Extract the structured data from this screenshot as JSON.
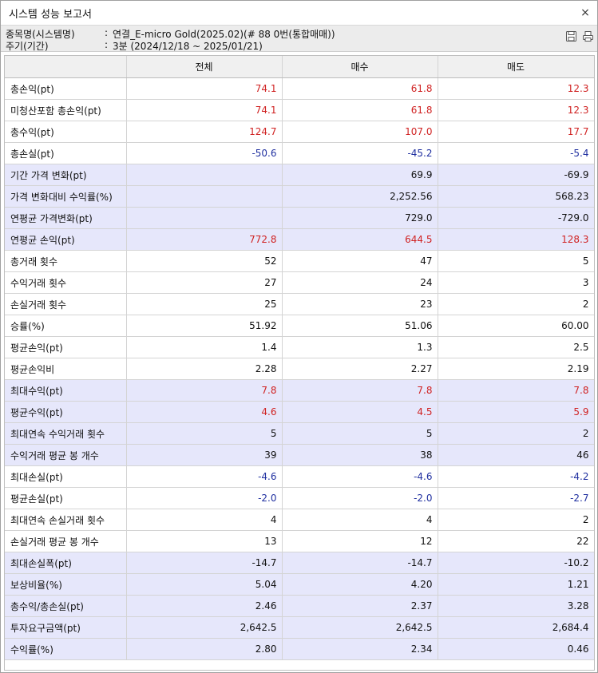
{
  "window": {
    "title": "시스템 성능 보고서",
    "close_glyph": "×"
  },
  "info": {
    "symbol_label": "종목명(시스템명)",
    "symbol_sep": ":",
    "symbol_value": "연결_E-micro Gold(2025.02)(# 88 0번(통합매매))",
    "period_label": "주기(기간)",
    "period_sep": ":",
    "period_value": "3분 (2024/12/18 ~ 2025/01/21)",
    "icons": [
      "save-icon",
      "print-icon"
    ]
  },
  "table": {
    "headers": [
      "",
      "전체",
      "매수",
      "매도"
    ],
    "rows": [
      {
        "label": "총손익(pt)",
        "values": [
          "74.1",
          "61.8",
          "12.3"
        ],
        "color": "red",
        "hl": false
      },
      {
        "label": "미청산포함 총손익(pt)",
        "values": [
          "74.1",
          "61.8",
          "12.3"
        ],
        "color": "red",
        "hl": false
      },
      {
        "label": "총수익(pt)",
        "values": [
          "124.7",
          "107.0",
          "17.7"
        ],
        "color": "red",
        "hl": false
      },
      {
        "label": "총손실(pt)",
        "values": [
          "-50.6",
          "-45.2",
          "-5.4"
        ],
        "color": "blue",
        "hl": false
      },
      {
        "label": "기간 가격 변화(pt)",
        "values": [
          "",
          "69.9",
          "-69.9"
        ],
        "color": "",
        "hl": true
      },
      {
        "label": "가격 변화대비 수익률(%)",
        "values": [
          "",
          "2,252.56",
          "568.23"
        ],
        "color": "",
        "hl": true
      },
      {
        "label": "연평균 가격변화(pt)",
        "values": [
          "",
          "729.0",
          "-729.0"
        ],
        "color": "",
        "hl": true
      },
      {
        "label": "연평균 손익(pt)",
        "values": [
          "772.8",
          "644.5",
          "128.3"
        ],
        "color": "red",
        "hl": true
      },
      {
        "label": "총거래 횟수",
        "values": [
          "52",
          "47",
          "5"
        ],
        "color": "",
        "hl": false
      },
      {
        "label": "수익거래 횟수",
        "values": [
          "27",
          "24",
          "3"
        ],
        "color": "",
        "hl": false
      },
      {
        "label": "손실거래 횟수",
        "values": [
          "25",
          "23",
          "2"
        ],
        "color": "",
        "hl": false
      },
      {
        "label": "승률(%)",
        "values": [
          "51.92",
          "51.06",
          "60.00"
        ],
        "color": "",
        "hl": false
      },
      {
        "label": "평균손익(pt)",
        "values": [
          "1.4",
          "1.3",
          "2.5"
        ],
        "color": "",
        "hl": false
      },
      {
        "label": "평균손익비",
        "values": [
          "2.28",
          "2.27",
          "2.19"
        ],
        "color": "",
        "hl": false
      },
      {
        "label": "최대수익(pt)",
        "values": [
          "7.8",
          "7.8",
          "7.8"
        ],
        "color": "red",
        "hl": true
      },
      {
        "label": "평균수익(pt)",
        "values": [
          "4.6",
          "4.5",
          "5.9"
        ],
        "color": "red",
        "hl": true
      },
      {
        "label": "최대연속 수익거래 횟수",
        "values": [
          "5",
          "5",
          "2"
        ],
        "color": "",
        "hl": true
      },
      {
        "label": "수익거래 평균 봉 개수",
        "values": [
          "39",
          "38",
          "46"
        ],
        "color": "",
        "hl": true
      },
      {
        "label": "최대손실(pt)",
        "values": [
          "-4.6",
          "-4.6",
          "-4.2"
        ],
        "color": "blue",
        "hl": false
      },
      {
        "label": "평균손실(pt)",
        "values": [
          "-2.0",
          "-2.0",
          "-2.7"
        ],
        "color": "blue",
        "hl": false
      },
      {
        "label": "최대연속 손실거래 횟수",
        "values": [
          "4",
          "4",
          "2"
        ],
        "color": "",
        "hl": false
      },
      {
        "label": "손실거래 평균 봉 개수",
        "values": [
          "13",
          "12",
          "22"
        ],
        "color": "",
        "hl": false
      },
      {
        "label": "최대손실폭(pt)",
        "values": [
          "-14.7",
          "-14.7",
          "-10.2"
        ],
        "color": "",
        "hl": true
      },
      {
        "label": "보상비율(%)",
        "values": [
          "5.04",
          "4.20",
          "1.21"
        ],
        "color": "",
        "hl": true
      },
      {
        "label": "총수익/총손실(pt)",
        "values": [
          "2.46",
          "2.37",
          "3.28"
        ],
        "color": "",
        "hl": true
      },
      {
        "label": "투자요구금액(pt)",
        "values": [
          "2,642.5",
          "2,642.5",
          "2,684.4"
        ],
        "color": "",
        "hl": true
      },
      {
        "label": "수익률(%)",
        "values": [
          "2.80",
          "2.34",
          "0.46"
        ],
        "color": "",
        "hl": true
      }
    ]
  }
}
